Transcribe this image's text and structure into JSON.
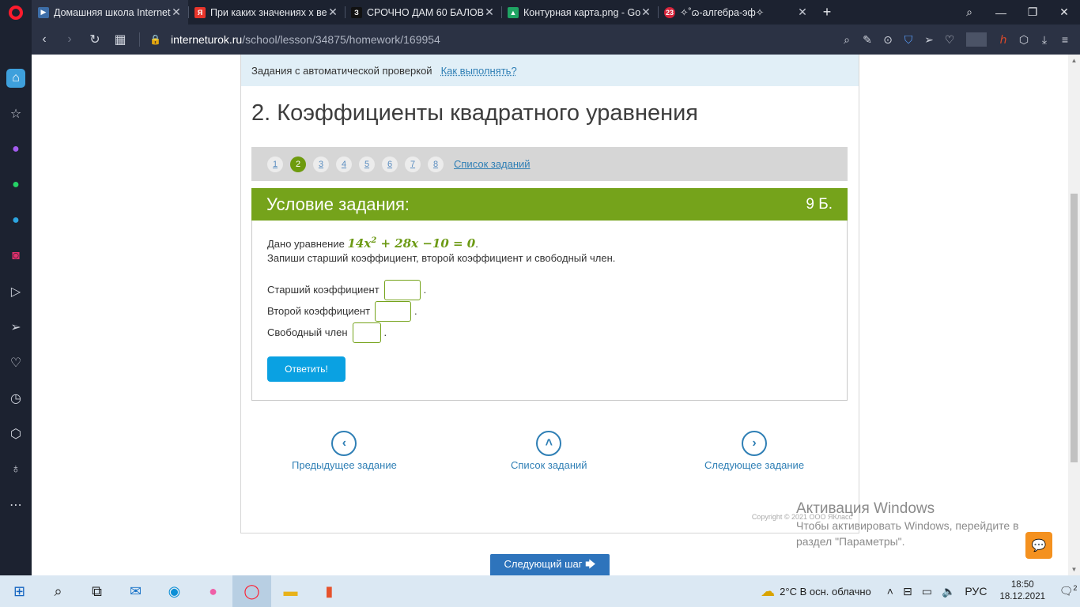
{
  "browser": {
    "tabs": [
      {
        "title": "Домашняя школа Internet",
        "fav_color": "#3d6ea8",
        "fav_glyph": "▶",
        "active": true
      },
      {
        "title": "При каких значениях х ве",
        "fav_color": "#e8352b",
        "fav_glyph": "Я",
        "active": false
      },
      {
        "title": "СРОЧНО ДАМ 60 БАЛОВ!",
        "fav_color": "#111111",
        "fav_glyph": "З",
        "active": false
      },
      {
        "title": "Контурная карта.png - Go",
        "fav_color": "#1fa463",
        "fav_glyph": "▲",
        "active": false
      },
      {
        "title": "✧˚ɷ-алгебра-эф✧",
        "fav_color": "#d6243b",
        "fav_glyph": "23",
        "active": false
      }
    ],
    "url_host": "interneturok.ru",
    "url_path": "/school/lesson/34875/homework/169954"
  },
  "page": {
    "infobar_text": "Задания с автоматической проверкой",
    "infobar_link": "Как выполнять?",
    "task_title": "2. Коэффициенты квадратного уравнения",
    "pager": {
      "numbers": [
        "1",
        "2",
        "3",
        "4",
        "5",
        "6",
        "7",
        "8"
      ],
      "current": "2",
      "list_link": "Список заданий"
    },
    "condition_header": "Условие задания:",
    "points": "9 Б.",
    "given_prefix": "Дано уравнение",
    "equation": {
      "a": "14",
      "x": "x",
      "exp": "2",
      "rest": "+ 28x −10 = 0",
      "dot": "."
    },
    "instruction": "Запиши старший коэффициент, второй коэффициент и свободный член.",
    "fields": [
      {
        "label": "Старший коэффициент",
        "value": ""
      },
      {
        "label": "Второй коэффициент",
        "value": ""
      },
      {
        "label": "Свободный член",
        "value": ""
      }
    ],
    "answer_button": "Ответить!",
    "nav": {
      "prev": "Предыдущее задание",
      "list": "Список заданий",
      "next": "Следующее задание"
    },
    "copyright": "Copyright © 2021 ООО ЯКласс",
    "next_step": "Следующий шаг 🡆"
  },
  "watermark": {
    "title": "Активация Windows",
    "body": "Чтобы активировать Windows, перейдите в раздел \"Параметры\"."
  },
  "taskbar": {
    "weather": "2°C  В осн. облачно",
    "lang": "РУС",
    "time": "18:50",
    "date": "18.12.2021",
    "notifications": "2"
  },
  "colors": {
    "accent_green": "#75a31b",
    "link_blue": "#2f7fb5",
    "answer_blue": "#0aa1e2"
  }
}
